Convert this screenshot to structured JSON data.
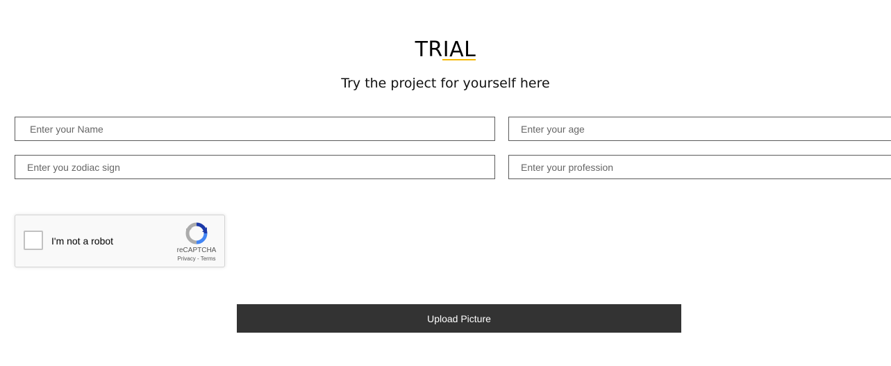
{
  "header": {
    "title": "TRIAL",
    "subtitle": "Try the project for yourself here",
    "accent_color": "#f5b800"
  },
  "form": {
    "name_placeholder": "Enter your Name",
    "age_placeholder": "Enter your age",
    "zodiac_placeholder": "Enter you zodiac sign",
    "profession_placeholder": "Enter your profession"
  },
  "captcha": {
    "label": "I'm not a robot",
    "brand": "reCAPTCHA",
    "privacy": "Privacy",
    "separator": " - ",
    "terms": "Terms",
    "checked": false,
    "icon": "recaptcha-logo-icon"
  },
  "upload": {
    "label": "Upload Picture",
    "background_color": "#333333"
  }
}
